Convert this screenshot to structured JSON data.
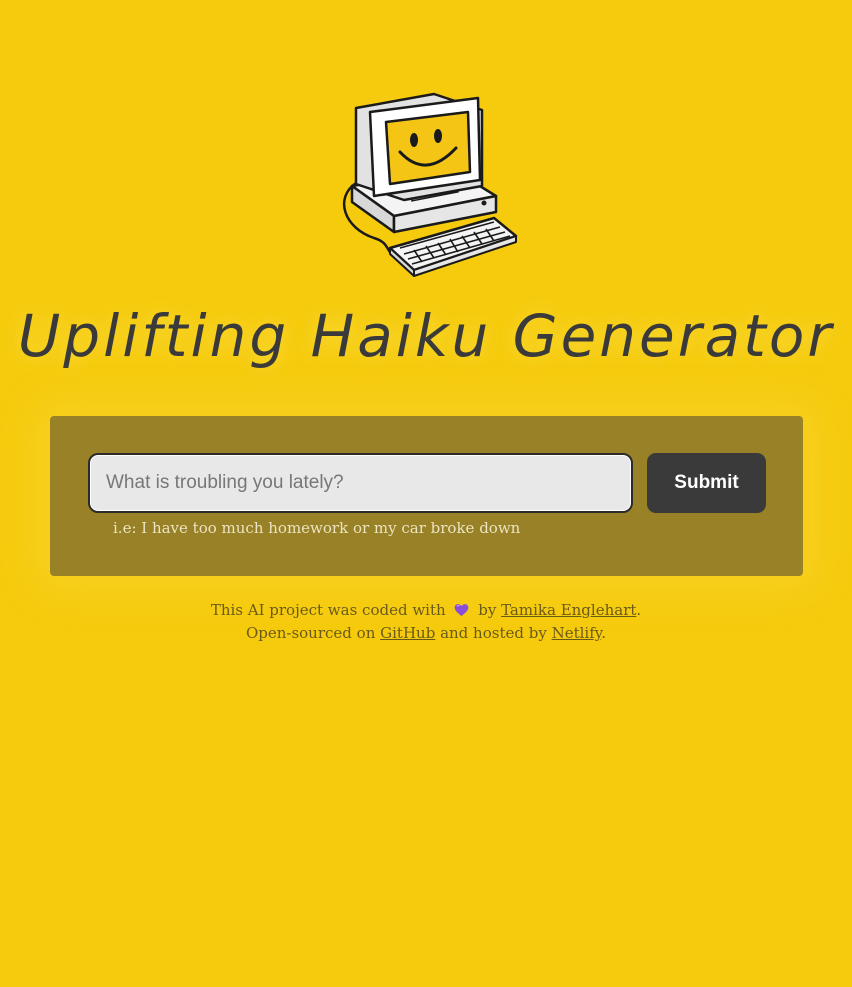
{
  "logo": {
    "icon": "smiling-computer-icon"
  },
  "title": "Uplifting Haiku Generator",
  "form": {
    "input_value": "",
    "input_placeholder": "What is troubling you lately?",
    "submit_label": "Submit",
    "hint": "i.e: I have too much homework or my car broke down"
  },
  "footer": {
    "line1_prefix": "This AI project was coded with",
    "heart_icon": "purple-heart-icon",
    "line1_by": "by",
    "author_link": "Tamika Englehart",
    "line1_suffix": ".",
    "line2_prefix": "Open-sourced on",
    "github_link": "GitHub",
    "line2_middle": "and hosted by",
    "netlify_link": "Netlify",
    "line2_suffix": "."
  },
  "colors": {
    "background": "#f6cb0d",
    "panel": "#988126",
    "button": "#3a3a3a",
    "heart": "#8a4fd6"
  }
}
